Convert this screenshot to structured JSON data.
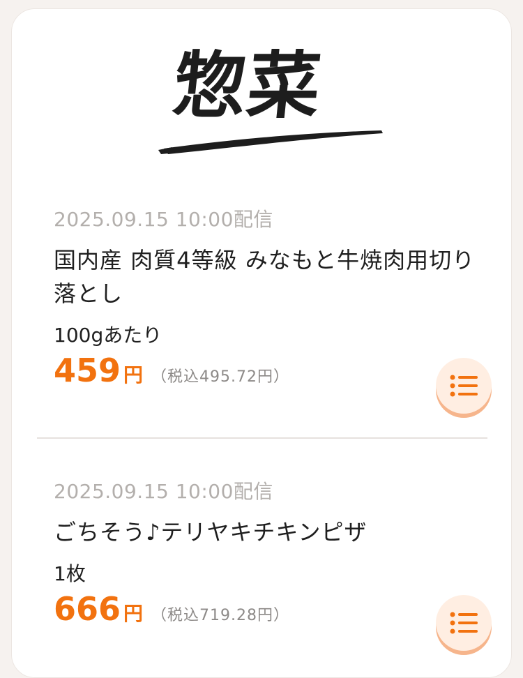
{
  "section": {
    "title": "惣菜"
  },
  "items": [
    {
      "date": "2025.09.15 10:00配信",
      "name": "国内産 肉質4等級 みなもと牛焼肉用切り落とし",
      "unit": "100gあたり",
      "price": "459",
      "yen": "円",
      "tax": "（税込495.72円）",
      "button_icon": "list-icon"
    },
    {
      "date": "2025.09.15 10:00配信",
      "name": "ごちそう♪テリヤキチキンピザ",
      "unit": "1枚",
      "price": "666",
      "yen": "円",
      "tax": "（税込719.28円）",
      "button_icon": "list-icon"
    }
  ],
  "colors": {
    "accent": "#f2720f",
    "button_bg": "#ffeee2",
    "date_text": "#b3afac",
    "body_text": "#1f1f1f"
  }
}
